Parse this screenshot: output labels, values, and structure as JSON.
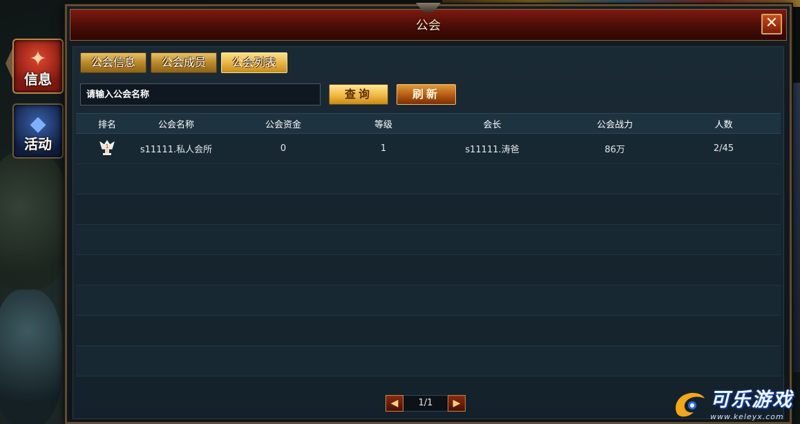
{
  "side_tabs": [
    {
      "label": "信息",
      "icon": "info-emblem-icon"
    },
    {
      "label": "活动",
      "icon": "activity-portal-icon"
    }
  ],
  "dialog": {
    "title": "公会",
    "close_icon": "close-icon"
  },
  "tabs": [
    {
      "label": "公会信息",
      "active": false
    },
    {
      "label": "公会成员",
      "active": false
    },
    {
      "label": "公会列表",
      "active": true
    }
  ],
  "search": {
    "placeholder": "请输入公会名称",
    "query_label": "查询",
    "refresh_label": "刷新"
  },
  "table": {
    "columns": [
      "排名",
      "公会名称",
      "公会资金",
      "等级",
      "会长",
      "公会战力",
      "人数"
    ],
    "rows": [
      {
        "rank_icon": "rank-1-trophy-icon",
        "name": "s11111.私人会所",
        "funds": "0",
        "level": "1",
        "leader": "s11111.涛爸",
        "power": "86万",
        "members": "2/45"
      }
    ]
  },
  "pagination": {
    "prev_icon": "prev-arrow-icon",
    "page": "1/1",
    "next_icon": "next-arrow-icon"
  },
  "watermark": {
    "brand": "可乐游戏",
    "url": "www.keleyx.com"
  },
  "colors": {
    "title_bar": "#5a1008",
    "gold": "#e7c26a",
    "panel": "#1a2a35"
  }
}
